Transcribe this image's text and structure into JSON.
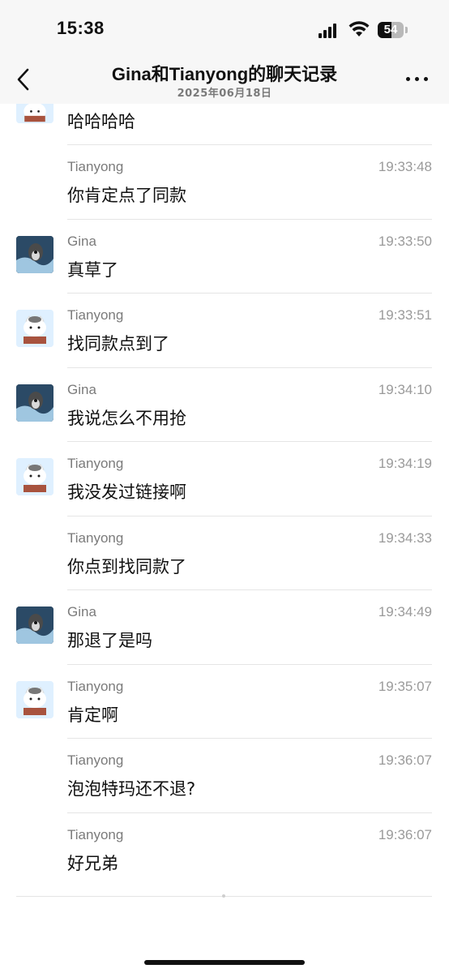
{
  "status_bar": {
    "time": "15:38",
    "battery": "54"
  },
  "header": {
    "title": "Gina和Tianyong的聊天记录",
    "subtitle": "2025年06月18日"
  },
  "first_message": {
    "text": "哈哈哈哈"
  },
  "messages": [
    {
      "sender": "Tianyong",
      "time": "19:33:48",
      "text": "你肯定点了同款"
    },
    {
      "sender": "Gina",
      "time": "19:33:50",
      "text": "真草了"
    },
    {
      "sender": "Tianyong",
      "time": "19:33:51",
      "text": "找同款点到了"
    },
    {
      "sender": "Gina",
      "time": "19:34:10",
      "text": "我说怎么不用抢"
    },
    {
      "sender": "Tianyong",
      "time": "19:34:19",
      "text": "我没发过链接啊"
    },
    {
      "sender": "Tianyong",
      "time": "19:34:33",
      "text": "你点到找同款了"
    },
    {
      "sender": "Gina",
      "time": "19:34:49",
      "text": "那退了是吗"
    },
    {
      "sender": "Tianyong",
      "time": "19:35:07",
      "text": "肯定啊"
    },
    {
      "sender": "Tianyong",
      "time": "19:36:07",
      "text": "泡泡特玛还不退?"
    },
    {
      "sender": "Tianyong",
      "time": "19:36:07",
      "text": "好兄弟"
    }
  ],
  "icons": {
    "back": "chevron-left-icon",
    "more": "more-dots-icon",
    "signal": "signal-icon",
    "wifi": "wifi-icon",
    "battery": "battery-icon"
  }
}
